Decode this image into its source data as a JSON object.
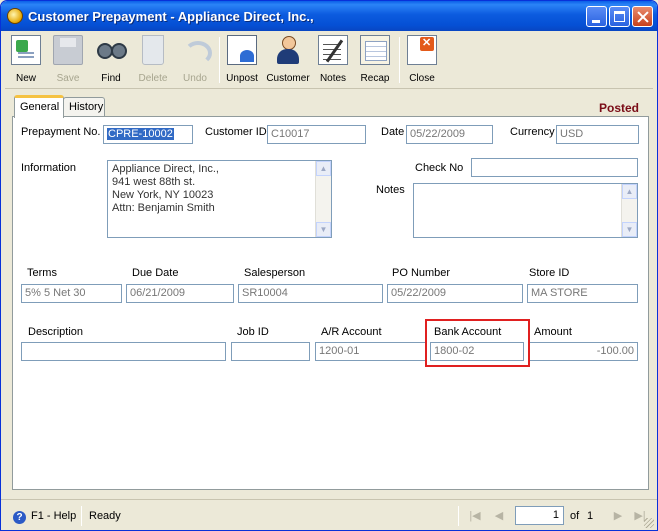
{
  "window": {
    "title": "Customer Prepayment - Appliance Direct, Inc.,"
  },
  "toolbar": {
    "new": "New",
    "save": "Save",
    "find": "Find",
    "delete": "Delete",
    "undo": "Undo",
    "unpost": "Unpost",
    "customer": "Customer",
    "notes": "Notes",
    "recap": "Recap",
    "close": "Close"
  },
  "tabs": {
    "general": "General",
    "history": "History"
  },
  "status": "Posted",
  "form": {
    "prepayment_no_label": "Prepayment No.",
    "prepayment_no": "CPRE-10002",
    "customer_id_label": "Customer ID",
    "customer_id": "C10017",
    "date_label": "Date",
    "date": "05/22/2009",
    "currency_label": "Currency",
    "currency": "USD",
    "information_label": "Information",
    "information_lines": [
      "Appliance Direct, Inc.,",
      "941 west 88th st.",
      "New York, NY 10023",
      "Attn: Benjamin Smith"
    ],
    "check_no_label": "Check No",
    "check_no": "",
    "notes_label": "Notes",
    "notes": "",
    "terms_label": "Terms",
    "terms": "5% 5 Net 30",
    "due_date_label": "Due Date",
    "due_date": "06/21/2009",
    "salesperson_label": "Salesperson",
    "salesperson": "SR10004",
    "po_number_label": "PO Number",
    "po_number": "05/22/2009",
    "store_id_label": "Store ID",
    "store_id": "MA STORE",
    "description_label": "Description",
    "description": "",
    "job_id_label": "Job ID",
    "job_id": "",
    "ar_account_label": "A/R Account",
    "ar_account": "1200-01",
    "bank_account_label": "Bank Account",
    "bank_account": "1800-02",
    "amount_label": "Amount",
    "amount": "-100.00"
  },
  "statusbar": {
    "help": "F1 - Help",
    "state": "Ready",
    "page_current": "1",
    "of_label": "of",
    "page_total": "1"
  },
  "colors": {
    "highlight": "#E02020",
    "posted": "#7A0C17",
    "titlebar": "#0550D5"
  }
}
